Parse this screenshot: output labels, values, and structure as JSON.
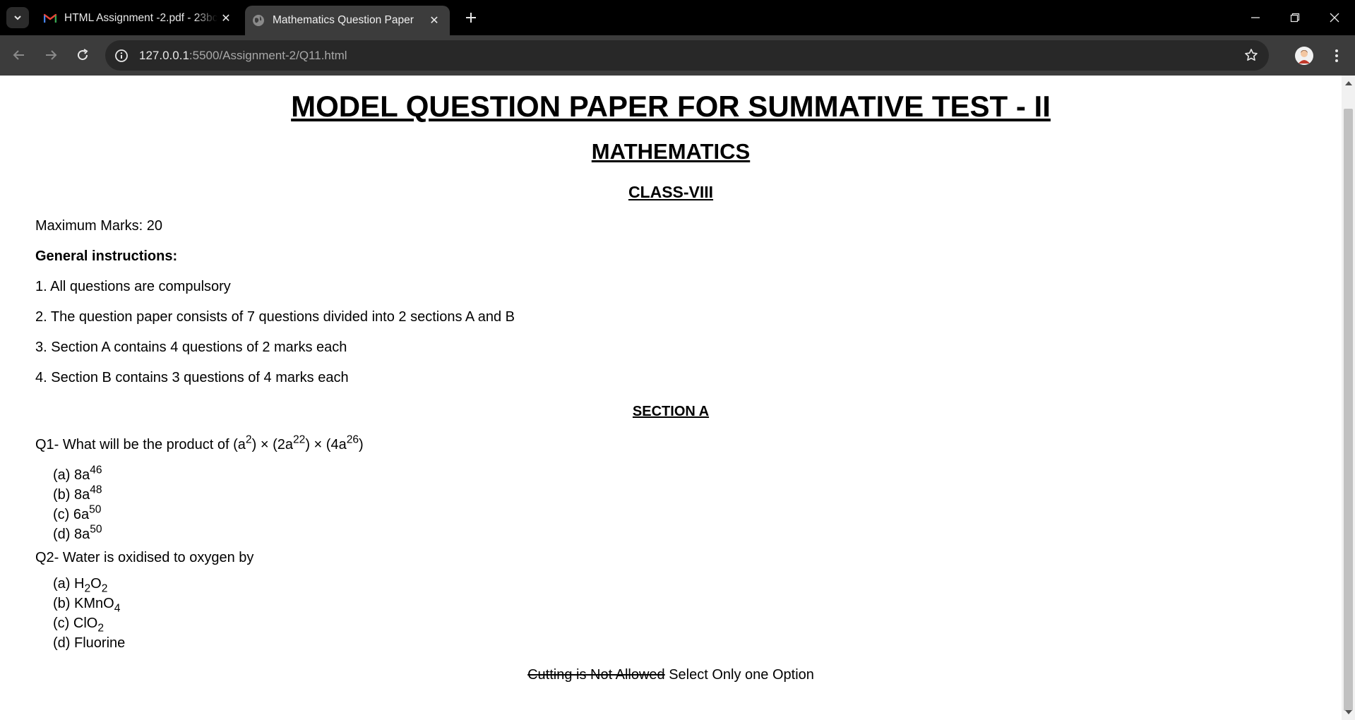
{
  "browser": {
    "tabs": [
      {
        "title": "HTML Assignment -2.pdf - 23bc",
        "icon": "gmail-icon",
        "active": false
      },
      {
        "title": "Mathematics Question Paper",
        "icon": "globe-icon",
        "active": true
      }
    ],
    "address": {
      "host": "127.0.0.1",
      "path": ":5500/Assignment-2/Q11.html"
    }
  },
  "page": {
    "title": "MODEL QUESTION PAPER FOR SUMMATIVE TEST - II",
    "subject": "MATHEMATICS",
    "class": "CLASS-VIII",
    "max_marks": "Maximum Marks: 20",
    "instructions_heading": "General instructions:",
    "instructions": [
      "1. All questions are compulsory",
      "2. The question paper consists of 7 questions divided into 2 sections A and B",
      "3. Section A contains 4 questions of 2 marks each",
      "4. Section B contains 3 questions of 4 marks each"
    ],
    "section_a": "SECTION A",
    "q1": {
      "prefix": "Q1- What will be the product of (a",
      "e1": "2",
      "mid1": ") × (2a",
      "e2": "22",
      "mid2": ") × (4a",
      "e3": "26",
      "end": ")",
      "options": [
        {
          "label": "(a) 8a",
          "exp": "46"
        },
        {
          "label": "(b) 8a",
          "exp": "48"
        },
        {
          "label": "(c) 6a",
          "exp": "50"
        },
        {
          "label": "(d) 8a",
          "exp": "50"
        }
      ]
    },
    "q2": {
      "text": "Q2- Water is oxidised to oxygen by",
      "opt_a": {
        "p1": "(a) H",
        "s1": "2",
        "p2": "O",
        "s2": "2"
      },
      "opt_b": {
        "p1": "(b) KMnO",
        "s1": "4"
      },
      "opt_c": {
        "p1": "(c) ClO",
        "s1": "2"
      },
      "opt_d": "(d) Fluorine"
    },
    "footer": {
      "struck": "Cutting is Not Allowed",
      "text": " Select Only one Option"
    }
  }
}
